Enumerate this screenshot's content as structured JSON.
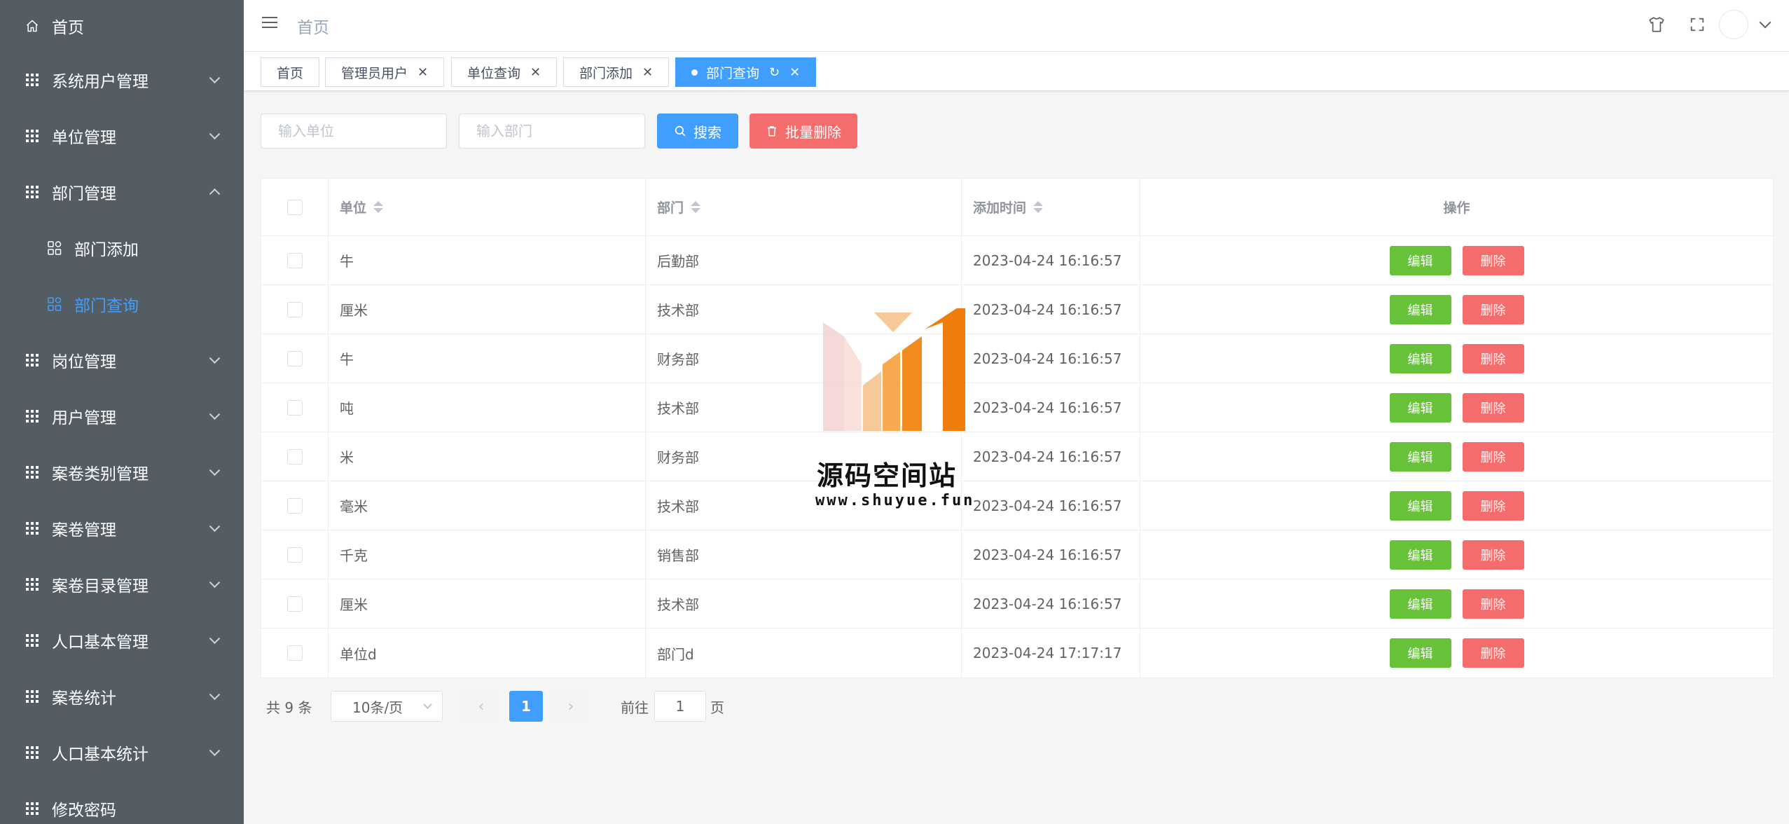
{
  "sidebar": {
    "items": [
      {
        "label": "首页",
        "icon": "home-icon"
      },
      {
        "label": "系统用户管理",
        "icon": "grid-icon"
      },
      {
        "label": "单位管理",
        "icon": "grid-icon"
      },
      {
        "label": "部门管理",
        "icon": "grid-icon",
        "expanded": true
      },
      {
        "label": "部门添加",
        "icon": "grid-outline-icon",
        "sub": true
      },
      {
        "label": "部门查询",
        "icon": "grid-outline-icon",
        "sub": true,
        "active": true
      },
      {
        "label": "岗位管理",
        "icon": "grid-icon"
      },
      {
        "label": "用户管理",
        "icon": "grid-icon"
      },
      {
        "label": "案卷类别管理",
        "icon": "grid-icon"
      },
      {
        "label": "案卷管理",
        "icon": "grid-icon"
      },
      {
        "label": "案卷目录管理",
        "icon": "grid-icon"
      },
      {
        "label": "人口基本管理",
        "icon": "grid-icon"
      },
      {
        "label": "案卷统计",
        "icon": "grid-icon"
      },
      {
        "label": "人口基本统计",
        "icon": "grid-icon"
      },
      {
        "label": "修改密码",
        "icon": "grid-icon"
      }
    ],
    "active_color": "#409eff",
    "bg_color": "#545c64"
  },
  "header": {
    "breadcrumb": "首页"
  },
  "tags": [
    {
      "label": "首页"
    },
    {
      "label": "管理员用户"
    },
    {
      "label": "单位查询"
    },
    {
      "label": "部门添加"
    },
    {
      "label": "部门查询",
      "active": true
    }
  ],
  "search": {
    "unit_placeholder": "输入单位",
    "dept_placeholder": "输入部门",
    "search_label": "搜索",
    "batch_delete_label": "批量删除"
  },
  "table": {
    "columns": [
      "单位",
      "部门",
      "添加时间",
      "操作"
    ],
    "rows": [
      {
        "unit": "牛",
        "dept": "后勤部",
        "time": "2023-04-24 16:16:57"
      },
      {
        "unit": "厘米",
        "dept": "技术部",
        "time": "2023-04-24 16:16:57"
      },
      {
        "unit": "牛",
        "dept": "财务部",
        "time": "2023-04-24 16:16:57"
      },
      {
        "unit": "吨",
        "dept": "技术部",
        "time": "2023-04-24 16:16:57"
      },
      {
        "unit": "米",
        "dept": "财务部",
        "time": "2023-04-24 16:16:57"
      },
      {
        "unit": "毫米",
        "dept": "技术部",
        "time": "2023-04-24 16:16:57"
      },
      {
        "unit": "千克",
        "dept": "销售部",
        "time": "2023-04-24 16:16:57"
      },
      {
        "unit": "厘米",
        "dept": "技术部",
        "time": "2023-04-24 16:16:57"
      },
      {
        "unit": "单位d",
        "dept": "部门d",
        "time": "2023-04-24 17:17:17"
      }
    ],
    "edit_label": "编辑",
    "delete_label": "删除"
  },
  "pagination": {
    "total_text": "共 9 条",
    "page_size": "10条/页",
    "current_page": "1",
    "goto_label": "前往",
    "goto_value": "1",
    "page_suffix": "页"
  },
  "watermark": {
    "title": "源码空间站",
    "url": "www.shuyue.fun"
  }
}
